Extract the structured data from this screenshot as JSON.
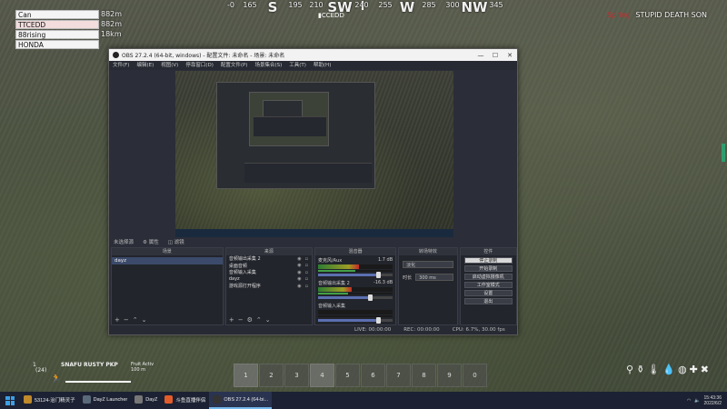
{
  "compass": {
    "marks": [
      {
        "label": "-0",
        "kind": "num"
      },
      {
        "label": "165",
        "kind": "num"
      },
      {
        "label": "S",
        "kind": "dir"
      },
      {
        "label": "195",
        "kind": "num"
      },
      {
        "label": "210",
        "kind": "num"
      },
      {
        "label": "SW",
        "kind": "dir"
      },
      {
        "label": "240",
        "kind": "num"
      },
      {
        "label": "255",
        "kind": "num"
      },
      {
        "label": "W",
        "kind": "dir"
      },
      {
        "label": "285",
        "kind": "num"
      },
      {
        "label": "300",
        "kind": "num"
      },
      {
        "label": "NW",
        "kind": "dir"
      },
      {
        "label": "345",
        "kind": "num"
      }
    ],
    "tag": "▮CCEDD"
  },
  "players": [
    {
      "name": "Can",
      "distance": "882m",
      "highlight": false
    },
    {
      "name": "TTCEDD",
      "distance": "882m",
      "highlight": true
    },
    {
      "name": "88rising",
      "distance": "18km",
      "highlight": false
    },
    {
      "name": "HONDA",
      "distance": "",
      "highlight": false
    }
  ],
  "killfeed": {
    "prefix": "Spring",
    "name": "STUPID DEATH SON"
  },
  "obs": {
    "title": "OBS 27.2.4 (64-bit, windows) - 配置文件: 未命名 - 场景: 未命名",
    "menu": [
      "文件(F)",
      "编辑(E)",
      "视图(V)",
      "停靠窗口(D)",
      "配置文件(P)",
      "场景集合(S)",
      "工具(T)",
      "帮助(H)"
    ],
    "scene_info": {
      "label": "未选择源",
      "props": "⚙ 属性",
      "filters": "◫ 滤镜"
    },
    "docks": {
      "scenes_header": "场景",
      "sources_header": "来源",
      "mixer_header": "混音器",
      "transitions_header": "转场特效",
      "controls_header": "控件"
    },
    "scenes": [
      "dayz"
    ],
    "sources": [
      "音频输出采集 2",
      "桌面音频",
      "音频输入采集",
      "dayz",
      "游戏源打开程序"
    ],
    "mixer": [
      {
        "name": "麦克风/Aux",
        "db": "1.7 dB",
        "level": 0.55,
        "volume": 0.82
      },
      {
        "name": "音频输出采集 2",
        "db": "-16.3 dB",
        "level": 0.45,
        "volume": 0.7
      },
      {
        "name": "音频输入采集",
        "db": "",
        "level": 0.0,
        "volume": 0.82
      }
    ],
    "transitions": {
      "type_label": "淡化",
      "duration_label": "时长",
      "duration_value": "300 ms"
    },
    "controls": [
      "停止录制",
      "开始录制",
      "启动虚拟摄像机",
      "工作室模式",
      "设置",
      "退出"
    ],
    "status": {
      "live": "LIVE: 00:00:00",
      "rec": "REC: 00:00:00",
      "cpu": "CPU: 6.7%, 30.00 fps"
    }
  },
  "hud": {
    "ammo_count": "1",
    "ammo_sub": "(24)",
    "weapon": "SNAFU RUSTY PKP",
    "zero_label": "Fruit Activ",
    "zero_value": "100 m",
    "hotbar": [
      "1",
      "2",
      "3",
      "4",
      "5",
      "6",
      "7",
      "8",
      "9",
      "0"
    ]
  },
  "taskbar": {
    "apps": [
      {
        "label": "53124-治门精灵子",
        "color": "#c08a2a",
        "active": false
      },
      {
        "label": "DayZ Launcher",
        "color": "#5a6a7a",
        "active": false
      },
      {
        "label": "DayZ",
        "color": "#777777",
        "active": false
      },
      {
        "label": "斗鱼直播伴侣",
        "color": "#e25c2b",
        "active": false
      },
      {
        "label": "OBS 27.2.4 (64-bi...",
        "color": "#333333",
        "active": true
      }
    ],
    "time": "15:43:36",
    "date": "2022/6/2"
  },
  "colors": {
    "accent": "#76b9ed",
    "obs_bg": "#2b2e38",
    "kill_prefix": "#c03030"
  }
}
